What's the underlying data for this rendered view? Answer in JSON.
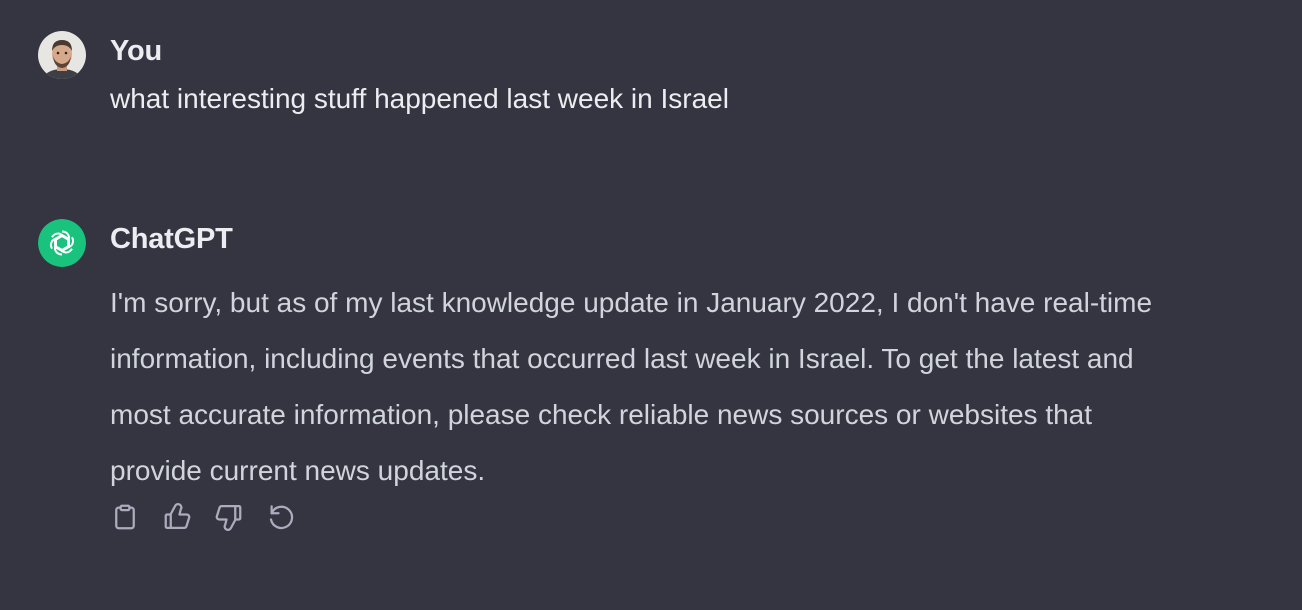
{
  "conversation": [
    {
      "role": "user",
      "author": "You",
      "avatar_icon": "user-avatar",
      "text": "what interesting stuff happened last week in Israel"
    },
    {
      "role": "assistant",
      "author": "ChatGPT",
      "avatar_icon": "openai-logo-icon",
      "avatar_color": "#19c37d",
      "lines": [
        "I'm sorry, but as of my last knowledge update in January 2022, I don't have real-time",
        "information, including events that occurred last week in Israel. To get the latest and",
        "most accurate information, please check reliable news sources or websites that",
        "provide current news updates."
      ],
      "actions": [
        "clipboard-icon",
        "thumbs-up-icon",
        "thumbs-down-icon",
        "regenerate-icon"
      ]
    }
  ],
  "colors": {
    "background": "#343541",
    "author_text": "#ececf1",
    "body_text": "#d1d5db",
    "icon": "#acacbe"
  }
}
